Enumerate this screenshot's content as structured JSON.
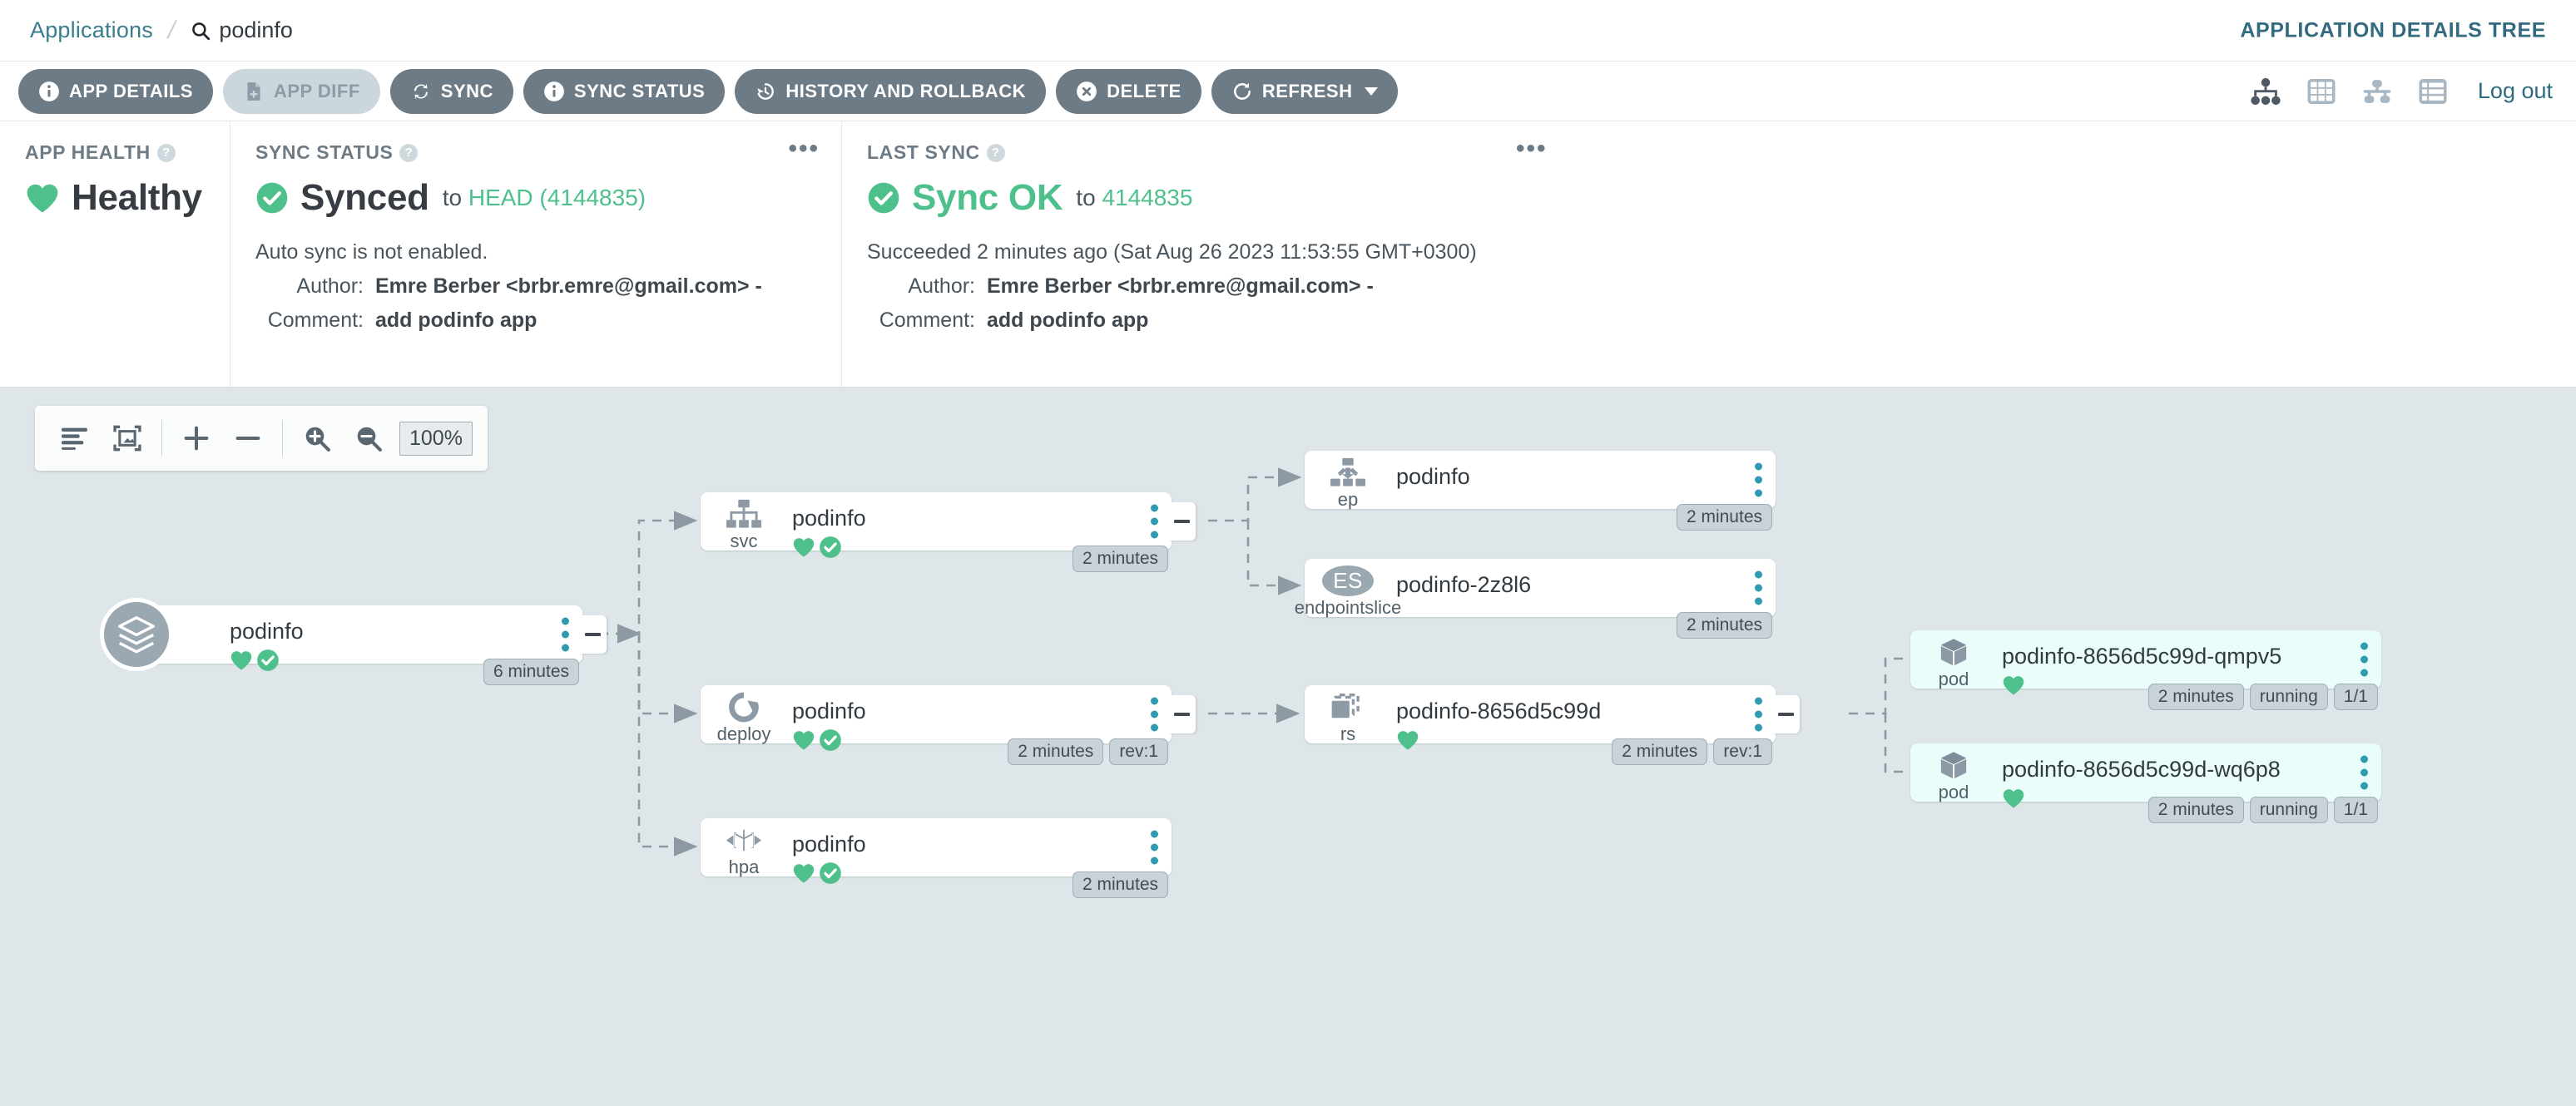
{
  "breadcrumb": {
    "applications_label": "Applications",
    "separator": "/",
    "current": "podinfo",
    "search_icon": "search-icon"
  },
  "header": {
    "details_tree_label": "APPLICATION DETAILS TREE",
    "logout_label": "Log out",
    "view_icons": [
      "tree-view-icon",
      "grid-view-icon",
      "network-view-icon",
      "list-view-icon"
    ]
  },
  "toolbar": {
    "buttons": [
      {
        "label": "APP DETAILS",
        "icon": "info-icon",
        "disabled": false
      },
      {
        "label": "APP DIFF",
        "icon": "file-diff-icon",
        "disabled": true
      },
      {
        "label": "SYNC",
        "icon": "sync-icon",
        "disabled": false
      },
      {
        "label": "SYNC STATUS",
        "icon": "info-icon",
        "disabled": false
      },
      {
        "label": "HISTORY AND ROLLBACK",
        "icon": "history-icon",
        "disabled": false
      },
      {
        "label": "DELETE",
        "icon": "delete-circle-icon",
        "disabled": false
      },
      {
        "label": "REFRESH",
        "icon": "refresh-icon",
        "disabled": false,
        "has_caret": true
      }
    ]
  },
  "panels": {
    "health": {
      "title": "APP HEALTH",
      "status": "Healthy",
      "icon": "heart-icon"
    },
    "sync_status": {
      "title": "SYNC STATUS",
      "status": "Synced",
      "to_label": "to",
      "revision": "HEAD (4144835)",
      "note": "Auto sync is not enabled.",
      "author_key": "Author:",
      "author_value": "Emre Berber <brbr.emre@gmail.com> -",
      "comment_key": "Comment:",
      "comment_value": "add podinfo app",
      "menu_icon": "kebab-horizontal-icon"
    },
    "last_sync": {
      "title": "LAST SYNC",
      "status": "Sync OK",
      "to_label": "to",
      "revision": "4144835",
      "note": "Succeeded 2 minutes ago (Sat Aug 26 2023 11:53:55 GMT+0300)",
      "author_key": "Author:",
      "author_value": "Emre Berber <brbr.emre@gmail.com> -",
      "comment_key": "Comment:",
      "comment_value": "add podinfo app",
      "menu_icon": "kebab-horizontal-icon"
    }
  },
  "graph_toolbar": {
    "icons": [
      "align-left-icon",
      "fit-to-screen-icon",
      "plus-icon",
      "minus-icon",
      "zoom-in-icon",
      "zoom-out-icon"
    ],
    "zoom_value": "100%"
  },
  "tree": {
    "nodes": [
      {
        "id": "app",
        "kind": "",
        "name": "podinfo",
        "icon": "layers-icon",
        "health": "healthy",
        "sync": "synced",
        "tags": [
          "6 minutes"
        ],
        "collapsible": true
      },
      {
        "id": "svc",
        "kind": "svc",
        "name": "podinfo",
        "icon": "service-icon",
        "health": "healthy",
        "sync": "synced",
        "tags": [
          "2 minutes"
        ],
        "collapsible": true
      },
      {
        "id": "deploy",
        "kind": "deploy",
        "name": "podinfo",
        "icon": "deployment-icon",
        "health": "healthy",
        "sync": "synced",
        "tags": [
          "2 minutes",
          "rev:1"
        ],
        "collapsible": true
      },
      {
        "id": "hpa",
        "kind": "hpa",
        "name": "podinfo",
        "icon": "hpa-icon",
        "health": "healthy",
        "sync": "synced",
        "tags": [
          "2 minutes"
        ],
        "collapsible": false
      },
      {
        "id": "ep",
        "kind": "ep",
        "name": "podinfo",
        "icon": "endpoints-icon",
        "health": "",
        "sync": "",
        "tags": [
          "2 minutes"
        ],
        "collapsible": false
      },
      {
        "id": "endpointslice",
        "kind": "endpointslice",
        "name": "podinfo-2z8l6",
        "icon": "endpointslice-badge",
        "badge_text": "ES",
        "health": "",
        "sync": "",
        "tags": [
          "2 minutes"
        ],
        "collapsible": false
      },
      {
        "id": "rs",
        "kind": "rs",
        "name": "podinfo-8656d5c99d",
        "icon": "replicaset-icon",
        "health": "healthy",
        "sync": "",
        "tags": [
          "2 minutes",
          "rev:1"
        ],
        "collapsible": true
      },
      {
        "id": "pod1",
        "kind": "pod",
        "name": "podinfo-8656d5c99d-qmpv5",
        "icon": "pod-cube-icon",
        "health": "healthy",
        "sync": "",
        "tags": [
          "2 minutes",
          "running",
          "1/1"
        ],
        "collapsible": false
      },
      {
        "id": "pod2",
        "kind": "pod",
        "name": "podinfo-8656d5c99d-wq6p8",
        "icon": "pod-cube-icon",
        "health": "healthy",
        "sync": "",
        "tags": [
          "2 minutes",
          "running",
          "1/1"
        ],
        "collapsible": false
      }
    ]
  },
  "colors": {
    "accent_teal": "#2f9bb0",
    "link_blue": "#3a7d8c",
    "healthy_green": "#4ec08c",
    "button_gray": "#6d7b86",
    "canvas_bg": "#dee6e9",
    "pod_bg": "#e9fdfb"
  }
}
